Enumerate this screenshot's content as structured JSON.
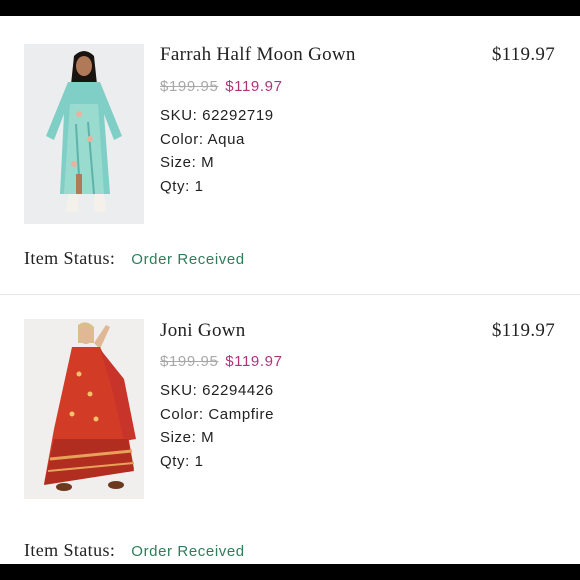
{
  "colors": {
    "sale_price": "#b0337a",
    "original_price": "#a8a8a8",
    "status": "#2e7d5b",
    "text": "#222222"
  },
  "order_items": [
    {
      "name": "Farrah Half Moon Gown",
      "total": "$119.97",
      "original_price": "$199.95",
      "sale_price": "$119.97",
      "sku": "SKU: 62292719",
      "color": "Color: Aqua",
      "size": "Size: M",
      "qty": "Qty: 1",
      "status_label": "Item Status:",
      "status_value": "Order Received"
    },
    {
      "name": "Joni Gown",
      "total": "$119.97",
      "original_price": "$199.95",
      "sale_price": "$119.97",
      "sku": "SKU: 62294426",
      "color": "Color: Campfire",
      "size": "Size: M",
      "qty": "Qty: 1",
      "status_label": "Item Status:",
      "status_value": "Order Received"
    }
  ]
}
